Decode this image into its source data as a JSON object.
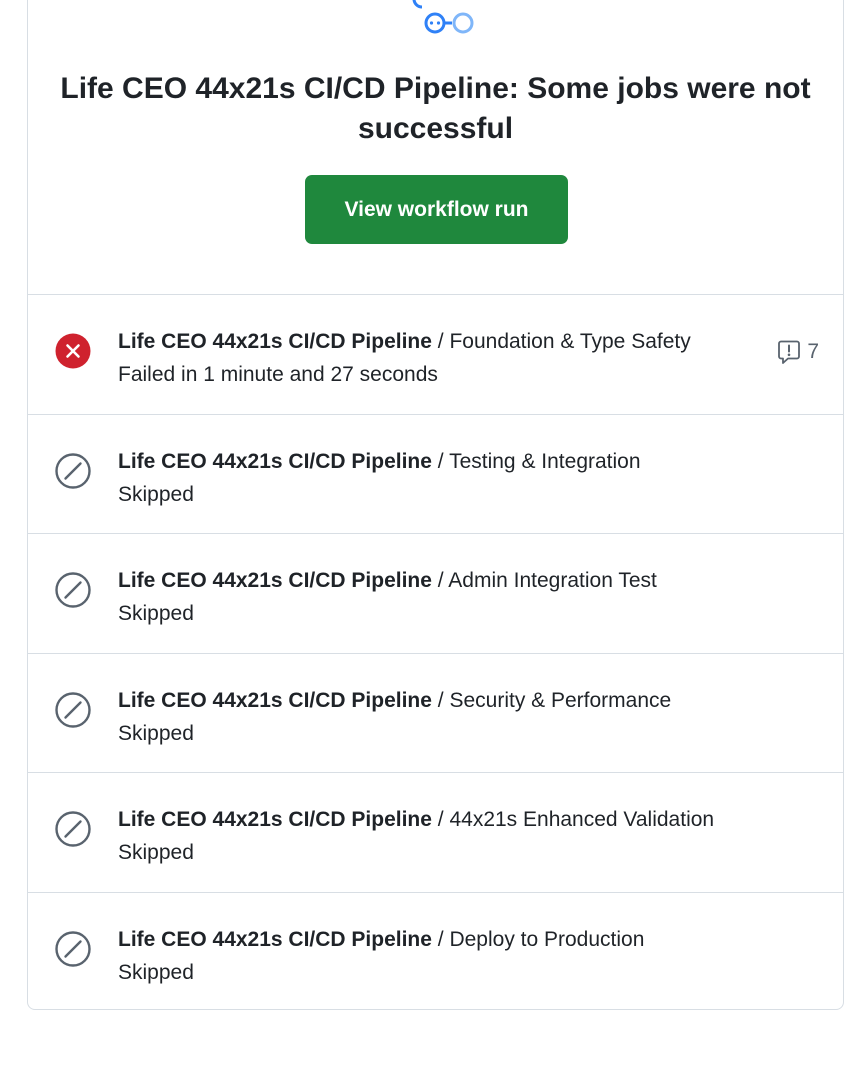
{
  "header": {
    "title": "Life CEO 44x21s CI/CD Pipeline: Some jobs were not successful",
    "button_label": "View workflow run",
    "logo_icon": "workflow-icon"
  },
  "colors": {
    "button": "#1f883d",
    "failure": "#cf222e",
    "skipped": "#59636e",
    "logo": "#2f81f7"
  },
  "jobs": [
    {
      "workflow": "Life CEO 44x21s CI/CD Pipeline",
      "name": " / Foundation & Type Safety",
      "status": "Failed in 1 minute and 27 seconds",
      "state": "failure",
      "icon": "x-circle-fill-icon",
      "annotations": "7",
      "annotations_icon": "comment-alert-icon"
    },
    {
      "workflow": "Life CEO 44x21s CI/CD Pipeline",
      "name": " / Testing & Integration",
      "status": "Skipped",
      "state": "skipped",
      "icon": "skip-icon"
    },
    {
      "workflow": "Life CEO 44x21s CI/CD Pipeline",
      "name": " / Admin Integration Test",
      "status": "Skipped",
      "state": "skipped",
      "icon": "skip-icon"
    },
    {
      "workflow": "Life CEO 44x21s CI/CD Pipeline",
      "name": " / Security & Performance",
      "status": "Skipped",
      "state": "skipped",
      "icon": "skip-icon"
    },
    {
      "workflow": "Life CEO 44x21s CI/CD Pipeline",
      "name": " / 44x21s Enhanced Validation",
      "status": "Skipped",
      "state": "skipped",
      "icon": "skip-icon"
    },
    {
      "workflow": "Life CEO 44x21s CI/CD Pipeline",
      "name": " / Deploy to Production",
      "status": "Skipped",
      "state": "skipped",
      "icon": "skip-icon"
    }
  ]
}
